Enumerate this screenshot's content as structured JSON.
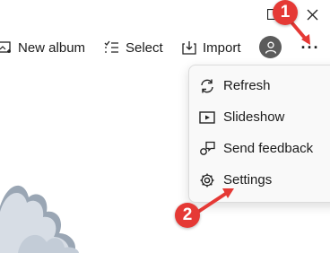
{
  "window_controls": {
    "maximize_icon": "maximize-icon",
    "close_icon": "close-icon"
  },
  "toolbar": {
    "new_album_label": "New album",
    "select_label": "Select",
    "import_label": "Import",
    "more_label": "···"
  },
  "menu": {
    "items": [
      {
        "label": "Refresh",
        "icon": "refresh-icon"
      },
      {
        "label": "Slideshow",
        "icon": "slideshow-icon"
      },
      {
        "label": "Send feedback",
        "icon": "feedback-icon"
      },
      {
        "label": "Settings",
        "icon": "gear-icon"
      }
    ]
  },
  "annotations": {
    "step1": "1",
    "step2": "2",
    "color": "#e53935"
  },
  "colors": {
    "avatar": "#5b5b5b",
    "cloud": "#d7dde5"
  }
}
